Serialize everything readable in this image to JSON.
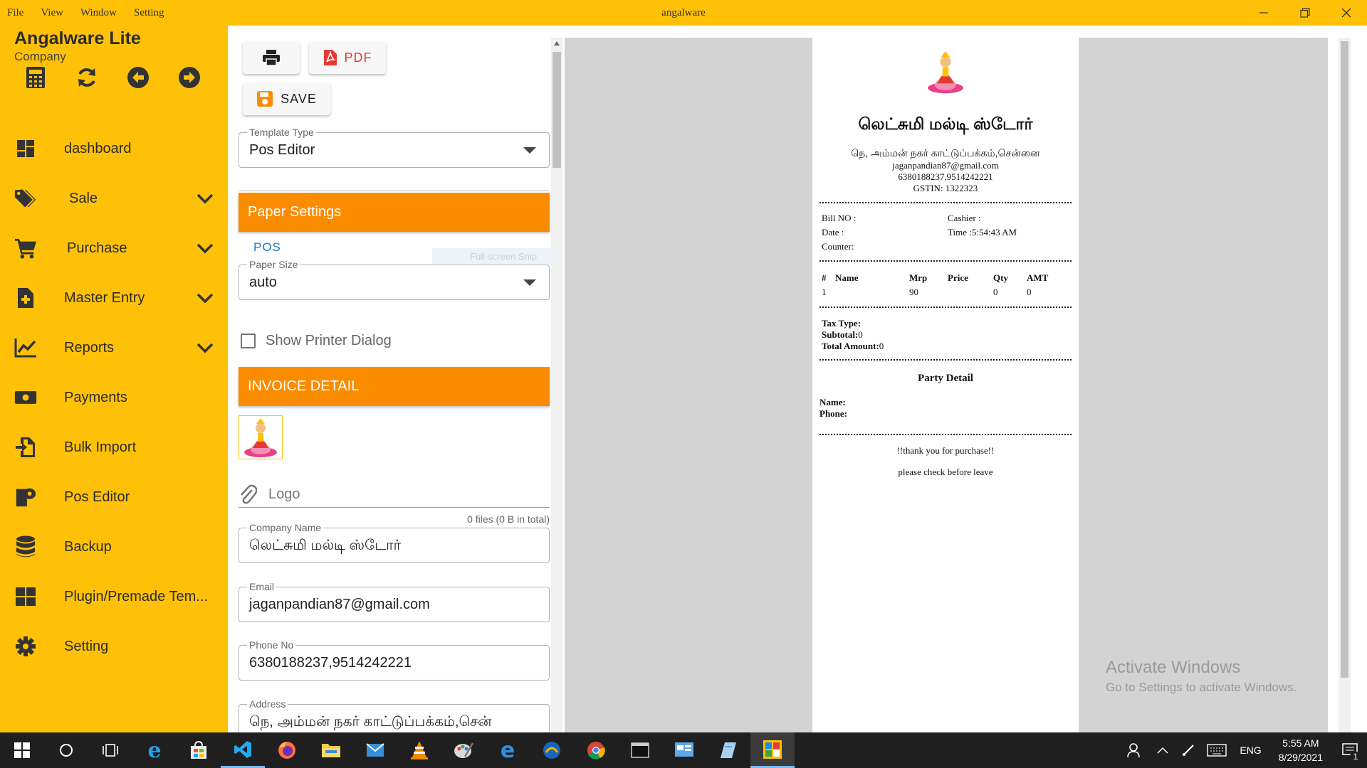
{
  "window": {
    "title": "angalware",
    "menu": [
      "File",
      "View",
      "Window",
      "Setting"
    ]
  },
  "sidebar": {
    "brand": "Angalware Lite",
    "subtitle": "Company",
    "quick_icons": [
      "calculator-icon",
      "refresh-icon",
      "back-arrow-icon",
      "forward-arrow-icon"
    ],
    "items": [
      {
        "label": "dashboard",
        "icon": "dashboard-icon",
        "expandable": false
      },
      {
        "label": "Sale",
        "icon": "tag-icon",
        "expandable": true
      },
      {
        "label": "Purchase",
        "icon": "cart-icon",
        "expandable": true
      },
      {
        "label": "Master Entry",
        "icon": "file-plus-icon",
        "expandable": true
      },
      {
        "label": "Reports",
        "icon": "chart-icon",
        "expandable": true
      },
      {
        "label": "Payments",
        "icon": "money-icon",
        "expandable": false
      },
      {
        "label": "Bulk Import",
        "icon": "import-icon",
        "expandable": false
      },
      {
        "label": "Pos Editor",
        "icon": "receipt-roll-icon",
        "expandable": false
      },
      {
        "label": "Backup",
        "icon": "database-icon",
        "expandable": false
      },
      {
        "label": "Plugin/Premade Tem...",
        "icon": "grid-icon",
        "expandable": false
      },
      {
        "label": "Setting",
        "icon": "gear-icon",
        "expandable": false
      }
    ]
  },
  "toolbar": {
    "pdf_label": "PDF",
    "save_label": "SAVE"
  },
  "form": {
    "template_type": {
      "label": "Template Type",
      "value": "Pos Editor"
    },
    "paper_settings_title": "Paper Settings",
    "paper_tab": "POS",
    "snip_hint": "Full-screen Snip",
    "paper_size": {
      "label": "Paper Size",
      "value": "auto"
    },
    "show_printer_dialog": "Show Printer Dialog",
    "invoice_detail_title": "INVOICE DETAIL",
    "logo_placeholder": "Logo",
    "file_count": "0 files (0 B in total)",
    "company_name": {
      "label": "Company Name",
      "value": "லெட்சுமி மல்டி ஸ்டோர்"
    },
    "email": {
      "label": "Email",
      "value": "jaganpandian87@gmail.com"
    },
    "phone": {
      "label": "Phone No",
      "value": "6380188237,9514242221"
    },
    "address": {
      "label": "Address",
      "value": "நெ, அம்மன் நகர் காட்டுப்பக்கம்,சென்"
    }
  },
  "receipt": {
    "store_name": "லெட்சுமி மல்டி ஸ்டோர்",
    "address": "நெ, அம்மன் நகர் காட்டுப்பக்கம்,சென்னை",
    "email": "jaganpandian87@gmail.com",
    "phone": "6380188237,9514242221",
    "gstin": "GSTIN: 1322323",
    "bill_no": "Bill NO :",
    "cashier": "Cashier :",
    "date": "Date :",
    "time": "Time :5:54:43 AM",
    "counter": "Counter:",
    "columns": [
      "#",
      "Name",
      "Mrp",
      "Price",
      "Qty",
      "AMT"
    ],
    "rows": [
      [
        "1",
        "",
        "90",
        "",
        "0",
        "0"
      ]
    ],
    "tax_type": "Tax Type:",
    "subtotal_label": "Subtotal:",
    "subtotal_value": "0",
    "total_label": "Total Amount:",
    "total_value": "0",
    "party_detail": "Party Detail",
    "name_label": "Name:",
    "phone_label": "Phone:",
    "thanks": "!!thank you for purchase!!",
    "note": "please check before leave"
  },
  "watermark": {
    "line1": "Activate Windows",
    "line2": "Go to Settings to activate Windows."
  },
  "taskbar": {
    "lang": "ENG",
    "time": "5:55 AM",
    "date": "8/29/2021",
    "notifications": "1"
  },
  "colors": {
    "sidebar": "#FFC107",
    "section_header": "#FB8C00",
    "pdf_red": "#E53935",
    "tab_blue": "#1976D2"
  }
}
